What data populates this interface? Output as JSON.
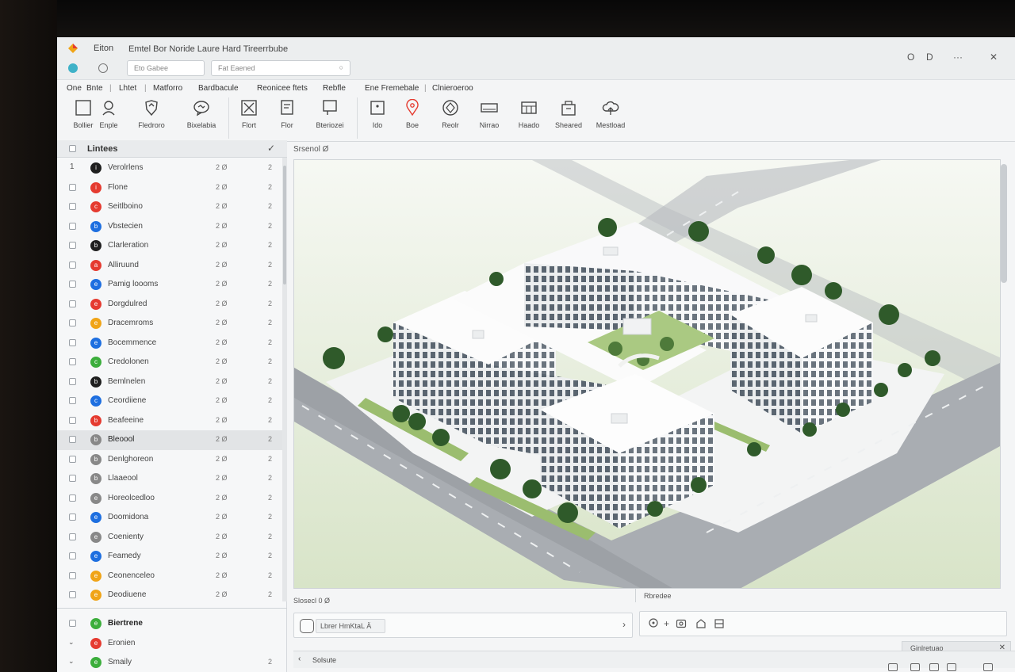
{
  "titlebar": {
    "app_menu": "Eiton",
    "doc_title": "Emtel Bor Noride Laure Hard Tireerrbube",
    "input1_placeholder": "Eto Gabee",
    "input2_placeholder": "Fat Eaened",
    "controls": [
      "O",
      "D",
      "···",
      "✕"
    ]
  },
  "ribbon_tabs": [
    "One",
    "Bnte",
    "|",
    "Lhtet",
    "|",
    "Matforro",
    "Bardbacule",
    "Reonicee ftets",
    "Rebfle",
    "Ene Fremebale",
    "|",
    "Clnieroeroo"
  ],
  "ribbon_tools": [
    {
      "label": "Bollier",
      "icon": "square-select-icon"
    },
    {
      "label": "Enple",
      "icon": "person-icon"
    },
    {
      "label": "Fledroro",
      "icon": "shield-icon"
    },
    {
      "label": "Bixelabia",
      "icon": "chat-icon"
    },
    {
      "label": "Flort",
      "icon": "x-box-icon"
    },
    {
      "label": "Flor",
      "icon": "document-icon"
    },
    {
      "label": "Bteriozei",
      "icon": "frame-icon"
    },
    {
      "label": "Ido",
      "icon": "square-dot-icon"
    },
    {
      "label": "Boe",
      "icon": "pin-icon"
    },
    {
      "label": "Reolr",
      "icon": "diamond-icon"
    },
    {
      "label": "Nirrao",
      "icon": "rect-icon"
    },
    {
      "label": "Haado",
      "icon": "grid-icon"
    },
    {
      "label": "Sheared",
      "icon": "bag-icon"
    },
    {
      "label": "Mestload",
      "icon": "cloud-upload-icon"
    }
  ],
  "panel": {
    "title": "Lintees",
    "items": [
      {
        "num": "1",
        "name": "Verolrlens",
        "value": "2 Ø",
        "count": "2",
        "color": "#1f1f1f",
        "glyph": "i"
      },
      {
        "name": "Flone",
        "value": "2 Ø",
        "count": "2",
        "color": "#e53b30",
        "glyph": "i"
      },
      {
        "name": "Seitlboino",
        "value": "2 Ø",
        "count": "2",
        "color": "#e53b30",
        "glyph": "c"
      },
      {
        "name": "Vbstecien",
        "value": "2 Ø",
        "count": "2",
        "color": "#1e6fe0",
        "glyph": "b"
      },
      {
        "name": "Clarleration",
        "value": "2 Ø",
        "count": "2",
        "color": "#1f1f1f",
        "glyph": "b"
      },
      {
        "name": "Alliruund",
        "value": "2 Ø",
        "count": "2",
        "color": "#e53b30",
        "glyph": "a"
      },
      {
        "name": "Pamig loooms",
        "value": "2 Ø",
        "count": "2",
        "color": "#1e6fe0",
        "glyph": "e"
      },
      {
        "name": "Dorgdulred",
        "value": "2 Ø",
        "count": "2",
        "color": "#e53b30",
        "glyph": "e"
      },
      {
        "name": "Dracemroms",
        "value": "2 Ø",
        "count": "2",
        "color": "#f0a417",
        "glyph": "e"
      },
      {
        "name": "Bocemmence",
        "value": "2 Ø",
        "count": "2",
        "color": "#1e6fe0",
        "glyph": "e"
      },
      {
        "name": "Credolonen",
        "value": "2 Ø",
        "count": "2",
        "color": "#3cae3c",
        "glyph": "c"
      },
      {
        "name": "Bemlnelen",
        "value": "2 Ø",
        "count": "2",
        "color": "#1f1f1f",
        "glyph": "b"
      },
      {
        "name": "Ceordiiene",
        "value": "2 Ø",
        "count": "2",
        "color": "#1e6fe0",
        "glyph": "c"
      },
      {
        "name": "Beafeeine",
        "value": "2 Ø",
        "count": "2",
        "color": "#e53b30",
        "glyph": "b"
      },
      {
        "name": "Bleoool",
        "value": "2 Ø",
        "count": "2",
        "color": "#888888",
        "glyph": "b"
      },
      {
        "name": "Denlghoreon",
        "value": "2 Ø",
        "count": "2",
        "color": "#888888",
        "glyph": "b"
      },
      {
        "name": "Llaaeool",
        "value": "2 Ø",
        "count": "2",
        "color": "#888888",
        "glyph": "b"
      },
      {
        "name": "Horeolcedloo",
        "value": "2 Ø",
        "count": "2",
        "color": "#888888",
        "glyph": "e"
      },
      {
        "name": "Doomidona",
        "value": "2 Ø",
        "count": "2",
        "color": "#1e6fe0",
        "glyph": "e"
      },
      {
        "name": "Coenienty",
        "value": "2 Ø",
        "count": "2",
        "color": "#888888",
        "glyph": "e"
      },
      {
        "name": "Feamedy",
        "value": "2 Ø",
        "count": "2",
        "color": "#1e6fe0",
        "glyph": "e"
      },
      {
        "name": "Ceonenceleo",
        "value": "2 Ø",
        "count": "2",
        "color": "#f0a417",
        "glyph": "e"
      },
      {
        "name": "Deodiuene",
        "value": "2 Ø",
        "count": "2",
        "color": "#f0a417",
        "glyph": "e"
      }
    ],
    "footer_items": [
      {
        "name": "Biertrene",
        "value": "",
        "count": "",
        "color": "#3cae3c",
        "glyph": "e"
      },
      {
        "name": "Eronien",
        "value": "",
        "count": "",
        "color": "#e53b30",
        "glyph": "e"
      },
      {
        "name": "Smaily",
        "value": "",
        "count": "2",
        "color": "#3cae3c",
        "glyph": "e"
      }
    ]
  },
  "viewport": {
    "breadcrumb": "Srsenol Ø",
    "scene": "isometric-building-3d-model"
  },
  "status": {
    "left": "Slosecl 0 Ø",
    "right": "Rbredee",
    "command_chip": "Lbrer HmKtaL Ä",
    "command_arrow": "›"
  },
  "bottom": {
    "nav_arrow": "‹",
    "nav_label": "Solsute",
    "mini_panel_label": "Ginlretuao",
    "mini_panel_close": "✕"
  },
  "colors": {
    "accent_blue": "#1e6fe0",
    "accent_red": "#e53b30",
    "accent_green": "#3cae3c",
    "accent_orange": "#f0a417"
  }
}
